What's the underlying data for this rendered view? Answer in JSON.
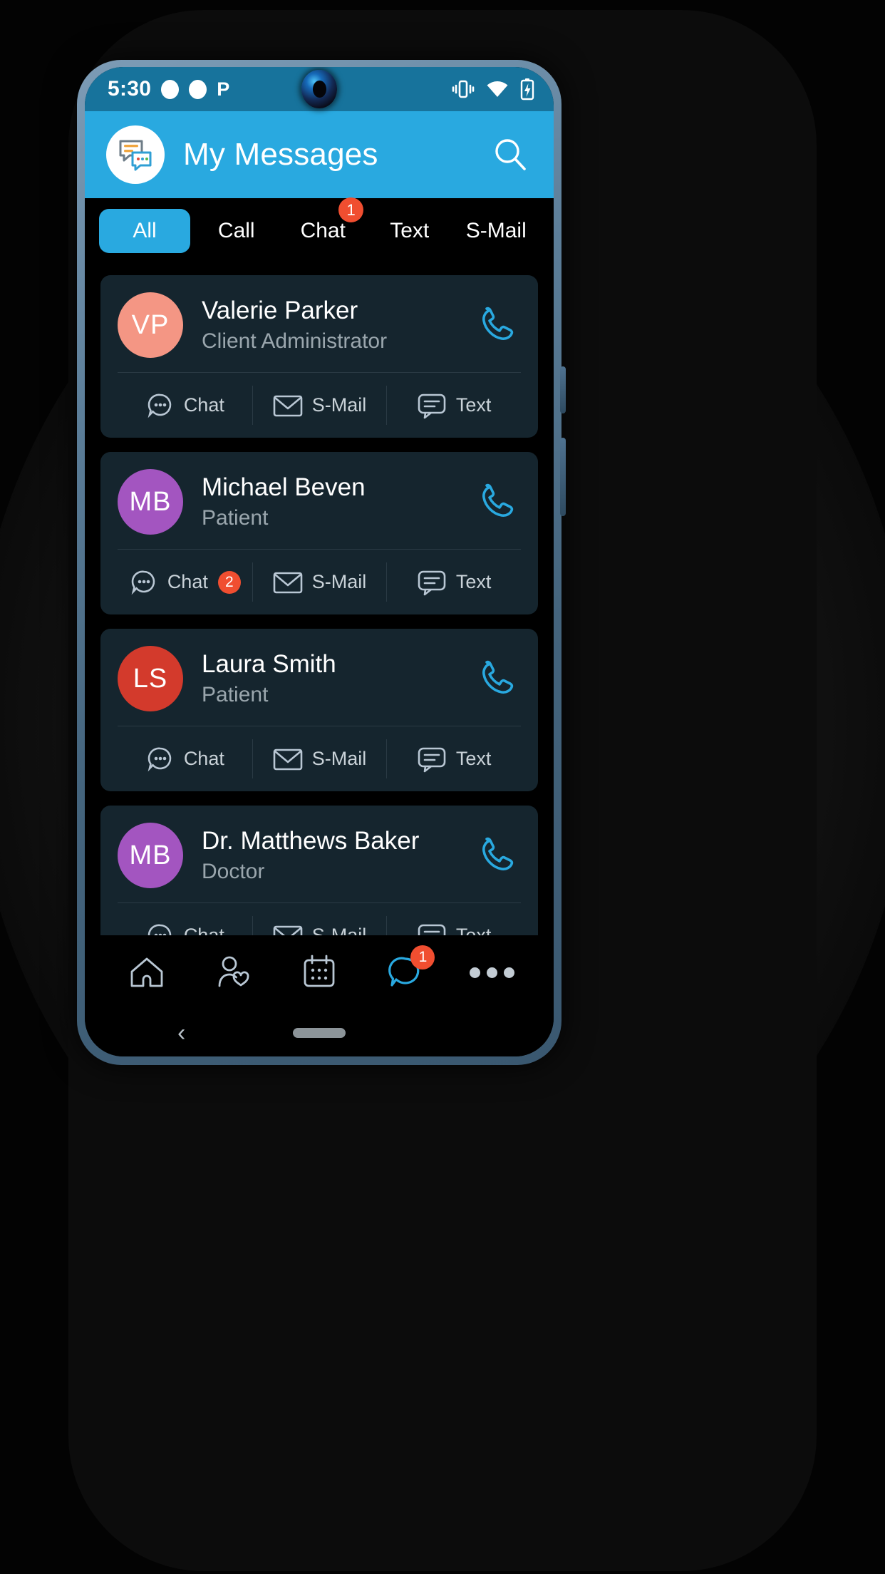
{
  "status_bar": {
    "time": "5:30",
    "icons": [
      "circle-indicator",
      "circle-indicator",
      "p-indicator",
      "vibrate-icon",
      "wifi-icon",
      "battery-charging-icon"
    ]
  },
  "header": {
    "title": "My Messages",
    "logo_icon": "messages-logo-icon",
    "search_icon": "search-icon",
    "background": "#29a9e0"
  },
  "tabs": [
    {
      "label": "All",
      "selected": true,
      "badge": ""
    },
    {
      "label": "Call",
      "selected": false,
      "badge": ""
    },
    {
      "label": "Chat",
      "selected": false,
      "badge": "1"
    },
    {
      "label": "Text",
      "selected": false,
      "badge": ""
    },
    {
      "label": "S-Mail",
      "selected": false,
      "badge": ""
    }
  ],
  "contacts": [
    {
      "initials": "VP",
      "avatar_color": "#f49684",
      "name": "Valerie Parker",
      "role": "Client Administrator",
      "call_icon": "phone-icon",
      "actions": [
        {
          "label": "Chat",
          "icon": "chat-bubble-dots-icon",
          "badge": ""
        },
        {
          "label": "S-Mail",
          "icon": "envelope-icon",
          "badge": ""
        },
        {
          "label": "Text",
          "icon": "text-bubble-lines-icon",
          "badge": ""
        }
      ]
    },
    {
      "initials": "MB",
      "avatar_color": "#a355c0",
      "name": "Michael Beven",
      "role": "Patient",
      "call_icon": "phone-icon",
      "actions": [
        {
          "label": "Chat",
          "icon": "chat-bubble-dots-icon",
          "badge": "2"
        },
        {
          "label": "S-Mail",
          "icon": "envelope-icon",
          "badge": ""
        },
        {
          "label": "Text",
          "icon": "text-bubble-lines-icon",
          "badge": ""
        }
      ]
    },
    {
      "initials": "LS",
      "avatar_color": "#d33a2c",
      "name": "Laura Smith",
      "role": "Patient",
      "call_icon": "phone-icon",
      "actions": [
        {
          "label": "Chat",
          "icon": "chat-bubble-dots-icon",
          "badge": ""
        },
        {
          "label": "S-Mail",
          "icon": "envelope-icon",
          "badge": ""
        },
        {
          "label": "Text",
          "icon": "text-bubble-lines-icon",
          "badge": ""
        }
      ]
    },
    {
      "initials": "MB",
      "avatar_color": "#a355c0",
      "name": "Dr. Matthews Baker",
      "role": "Doctor",
      "call_icon": "phone-icon",
      "actions": [
        {
          "label": "Chat",
          "icon": "chat-bubble-dots-icon",
          "badge": ""
        },
        {
          "label": "S-Mail",
          "icon": "envelope-icon",
          "badge": ""
        },
        {
          "label": "Text",
          "icon": "text-bubble-lines-icon",
          "badge": ""
        }
      ]
    }
  ],
  "bottom_nav": [
    {
      "icon": "home-icon",
      "badge": "",
      "active": false
    },
    {
      "icon": "patient-care-icon",
      "badge": "",
      "active": false
    },
    {
      "icon": "calendar-icon",
      "badge": "",
      "active": false
    },
    {
      "icon": "messages-icon",
      "badge": "1",
      "active": true
    },
    {
      "icon": "more-icon",
      "badge": "",
      "active": false
    }
  ],
  "system_bar": {
    "back_glyph": "‹",
    "home_pill": "home-indicator"
  },
  "theme": {
    "accent": "#29a9e0",
    "statusbar": "#17739c",
    "card_bg": "#15252e",
    "badge_red": "#f04e30",
    "icon_stroke": "#b9c7d4",
    "muted_text": "#9aa6ad"
  }
}
